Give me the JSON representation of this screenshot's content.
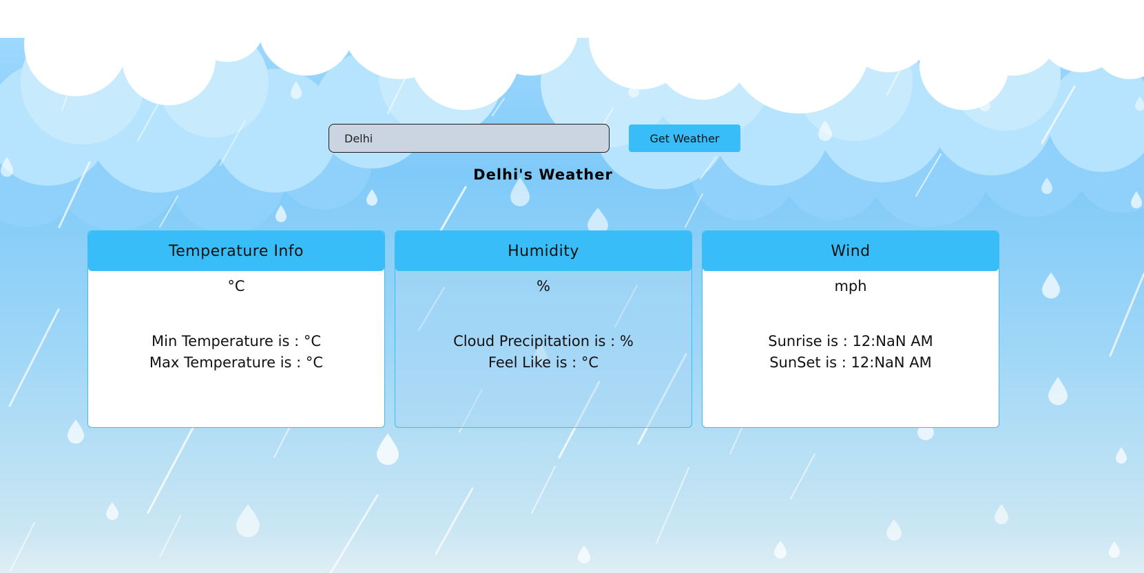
{
  "search": {
    "value": "Delhi",
    "button_label": "Get Weather"
  },
  "title": "Delhi's Weather",
  "cards": [
    {
      "header": "Temperature Info",
      "main": "°C",
      "line1": "Min Temperature is : °C",
      "line2": "Max Temperature is : °C"
    },
    {
      "header": "Humidity",
      "main": "%",
      "line1": "Cloud Precipitation is : %",
      "line2": "Feel Like is : °C"
    },
    {
      "header": "Wind",
      "main": "mph",
      "line1": "Sunrise is : 12:NaN AM",
      "line2": "SunSet is : 12:NaN AM"
    }
  ],
  "colors": {
    "accent": "#38bdf8",
    "input_bg": "#cbd5e1",
    "sky": "#7fcaf9"
  },
  "icons": [
    "cloud-icon",
    "raindrop-icon"
  ]
}
